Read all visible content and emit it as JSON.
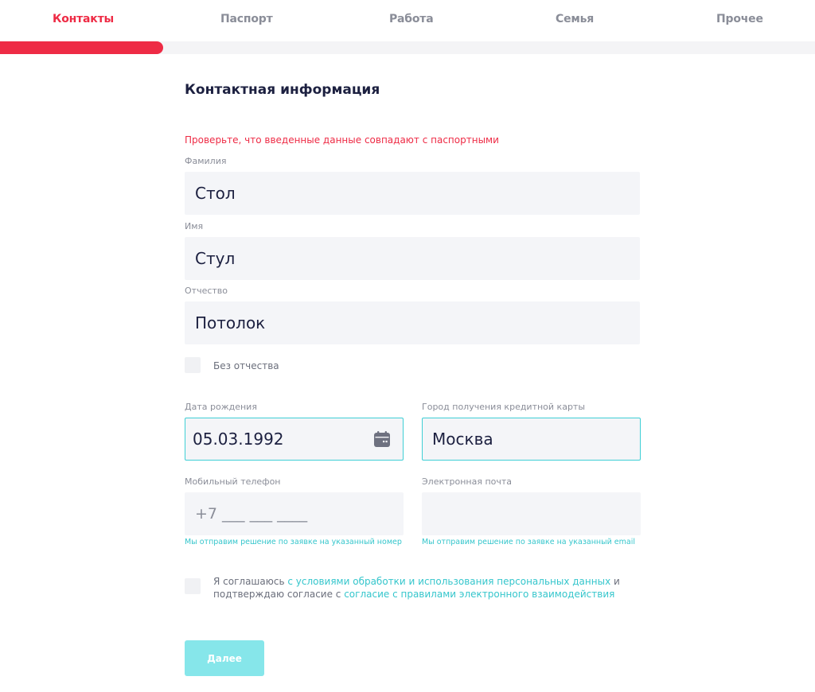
{
  "tabs": {
    "contacts": "Контакты",
    "passport": "Паспорт",
    "work": "Работа",
    "family": "Семья",
    "other": "Прочее"
  },
  "progress": {
    "fraction": 0.2
  },
  "form": {
    "title": "Контактная информация",
    "warning": "Проверьте, что введенные данные совпадают с паспортными",
    "last_name": {
      "label": "Фамилия",
      "value": "Стол"
    },
    "first_name": {
      "label": "Имя",
      "value": "Стул"
    },
    "patronymic": {
      "label": "Отчество",
      "value": "Потолок"
    },
    "no_patronymic_label": "Без отчества",
    "birth_date": {
      "label": "Дата рождения",
      "value": "05.03.1992"
    },
    "city": {
      "label": "Город получения кредитной карты",
      "value": "Москва"
    },
    "phone": {
      "label": "Мобильный телефон",
      "placeholder": "+7 ___ ___ ____",
      "hint": "Мы отправим решение по заявке на указанный номер"
    },
    "email": {
      "label": "Электронная почта",
      "value": "",
      "hint": "Мы отправим решение по заявке на указанный email"
    },
    "consent": {
      "prefix": "Я соглашаюсь ",
      "link1": "с условиями обработки и использования персональных данных",
      "middle": " и подтверждаю согласие с ",
      "link2": "согласие с правилами электронного взаимодействия"
    },
    "next_button": "Далее"
  },
  "colors": {
    "accent": "#ee2b45",
    "teal": "#3fcfd5",
    "button": "#86e6ea"
  }
}
